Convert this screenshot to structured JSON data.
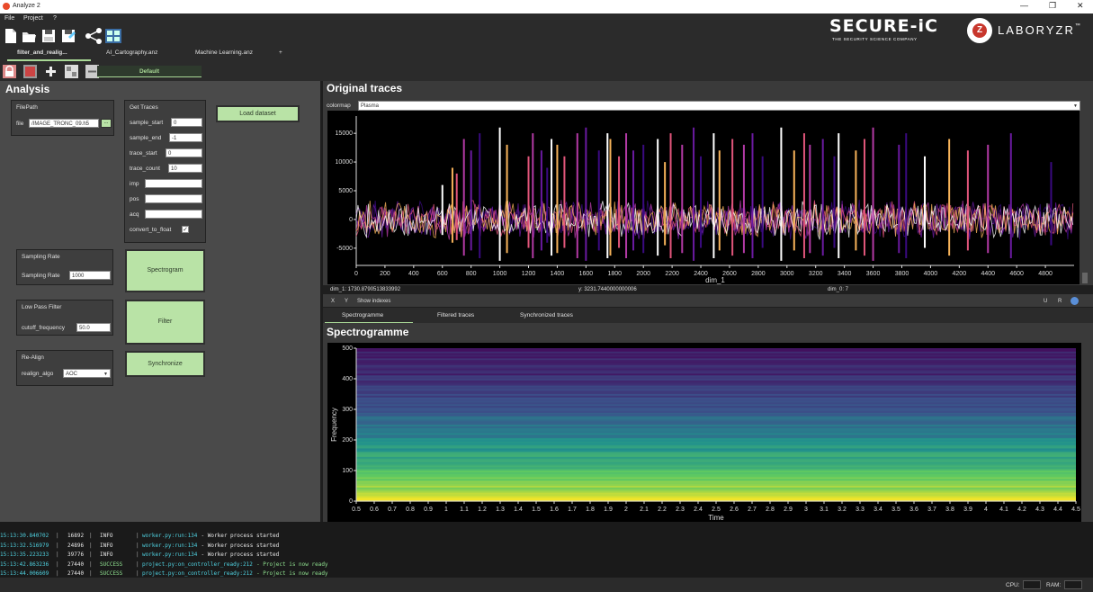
{
  "window": {
    "title": "Analyze 2",
    "controls": [
      "—",
      "❐",
      "✕"
    ]
  },
  "menu": [
    "File",
    "Project",
    "?"
  ],
  "toolbar": {
    "icons": [
      "new-file-icon",
      "open-folder-icon",
      "save-icon",
      "save-as-icon",
      "share-network-icon",
      "grid-layout-icon"
    ]
  },
  "brand": {
    "secure_main": "SECURE-iC",
    "secure_tagline": "THE SECURITY SCIENCE COMPANY",
    "lab_logo_letter": "Z",
    "lab_name": "LABORYZR",
    "lab_tm": "™"
  },
  "tabs": [
    {
      "label": "filter_and_realig..."
    },
    {
      "label": "AI_Cartography.anz"
    },
    {
      "label": "Machine Learning.anz"
    },
    {
      "label": "+"
    }
  ],
  "subbar": {
    "default_label": "Default"
  },
  "analysis": {
    "title": "Analysis",
    "filepath": {
      "title": "FilePath",
      "file_label": "file",
      "file_value": "/IMAGE_TRONC_09.h5",
      "browse_label": "..."
    },
    "get_traces": {
      "title": "Get Traces",
      "fields": [
        {
          "label": "sample_start",
          "value": "0"
        },
        {
          "label": "sample_end",
          "value": "-1"
        },
        {
          "label": "trace_start",
          "value": "0"
        },
        {
          "label": "trace_count",
          "value": "10"
        },
        {
          "label": "imp",
          "value": ""
        },
        {
          "label": "pos",
          "value": ""
        },
        {
          "label": "acq",
          "value": ""
        }
      ],
      "convert_label": "convert_to_float",
      "convert_checked": "✓"
    },
    "load_dataset_label": "Load dataset",
    "sampling": {
      "title": "Sampling Rate",
      "label": "Sampling Rate",
      "value": "1000",
      "button": "Spectrogram"
    },
    "lowpass": {
      "title": "Low Pass Filter",
      "label": "cutoff_frequency",
      "value": "50.0",
      "button": "Filter"
    },
    "realign": {
      "title": "Re-Align",
      "label": "realign_algo",
      "value": "AOC",
      "button": "Synchronize"
    }
  },
  "traces": {
    "title": "Original traces",
    "colormap_label": "colormap",
    "colormap_value": "Plasma",
    "status": {
      "dim1": "dim_1: 1730.8790513833992",
      "y": "y: 3231.7440000000006",
      "dim0": "dim_0: 7"
    },
    "tools": {
      "x": "X",
      "y": "Y",
      "show_indexes": "Show indexes",
      "u": "U",
      "r": "R"
    }
  },
  "bottom_tabs": [
    "Spectrogramme",
    "Filtered traces",
    "Synchronized traces"
  ],
  "spectrogram": {
    "title": "Spectrogramme"
  },
  "chart_data": [
    {
      "type": "line",
      "title": "",
      "xlabel": "dim_1",
      "ylabel": "",
      "xlim": [
        0,
        5000
      ],
      "ylim": [
        -8000,
        18000
      ],
      "x_ticks": [
        "0",
        "200",
        "400",
        "600",
        "800",
        "1000",
        "1200",
        "1400",
        "1600",
        "1800",
        "2000",
        "2200",
        "2400",
        "2600",
        "2800",
        "3000",
        "3200",
        "3400",
        "3600",
        "3800",
        "4000",
        "4200",
        "4400",
        "4600",
        "4800"
      ],
      "y_ticks": [
        "15000",
        "10000",
        "5000",
        "0",
        "-5000"
      ],
      "series_colors": [
        "#ffffff",
        "#f7b35a",
        "#e0557a",
        "#b33aa5",
        "#6a1aa0",
        "#3a0a80"
      ],
      "spike_positions": [
        600,
        670,
        700,
        750,
        800,
        860,
        1000,
        1050,
        1200,
        1230,
        1290,
        1330,
        1360,
        1400,
        1450,
        1540,
        1600,
        1690,
        1750,
        1770,
        1830,
        1880,
        1930,
        2000,
        2100,
        2150,
        2190,
        2270,
        2350,
        2400,
        2490,
        2530,
        2620,
        2700,
        2760,
        2830,
        2960,
        3050,
        3120,
        3160,
        3250,
        3330,
        3360,
        3480,
        3540,
        3600,
        3780,
        3830,
        3960,
        4130,
        4260,
        4400,
        4560,
        4840
      ],
      "spike_heights": [
        6000,
        9000,
        8000,
        14000,
        12000,
        15000,
        16000,
        13000,
        11000,
        15000,
        12000,
        9000,
        14000,
        13000,
        11000,
        15000,
        16000,
        12000,
        15000,
        14000,
        11000,
        15000,
        12000,
        13000,
        14000,
        10000,
        15000,
        13000,
        16000,
        11000,
        15000,
        12000,
        14000,
        13000,
        15000,
        11000,
        16000,
        12000,
        15000,
        13000,
        14000,
        11000,
        15000,
        12000,
        14000,
        16000,
        13000,
        15000,
        11000,
        14000,
        12000,
        13000,
        15000,
        10000
      ]
    },
    {
      "type": "heatmap",
      "title": "",
      "xlabel": "Time",
      "ylabel": "Frequency",
      "xlim": [
        0.5,
        4.5
      ],
      "ylim": [
        0,
        500
      ],
      "x_ticks": [
        "0.5",
        "0.6",
        "0.7",
        "0.8",
        "0.9",
        "1",
        "1.1",
        "1.2",
        "1.3",
        "1.4",
        "1.5",
        "1.6",
        "1.7",
        "1.8",
        "1.9",
        "2",
        "2.1",
        "2.2",
        "2.3",
        "2.4",
        "2.5",
        "2.6",
        "2.7",
        "2.8",
        "2.9",
        "3",
        "3.1",
        "3.2",
        "3.3",
        "3.4",
        "3.5",
        "3.6",
        "3.7",
        "3.8",
        "3.9",
        "4",
        "4.1",
        "4.2",
        "4.3",
        "4.4",
        "4.5"
      ],
      "y_ticks": [
        "500",
        "400",
        "300",
        "200",
        "100",
        "0"
      ],
      "colormap": [
        "#440154",
        "#3b528b",
        "#21918c",
        "#5ec962",
        "#fde725"
      ]
    }
  ],
  "console": [
    {
      "time": "15:13:30.840702",
      "pid": "16892",
      "level": "INFO",
      "src": "worker.py:run:134",
      "msg": "- Worker process started"
    },
    {
      "time": "15:13:32.516979",
      "pid": "24896",
      "level": "INFO",
      "src": "worker.py:run:134",
      "msg": "- Worker process started"
    },
    {
      "time": "15:13:35.223233",
      "pid": "39776",
      "level": "INFO",
      "src": "worker.py:run:134",
      "msg": "- Worker process started"
    },
    {
      "time": "15:13:42.863236",
      "pid": "27440",
      "level": "SUCCESS",
      "src": "project.py:on_controller_ready:212",
      "msg": "- Project is now ready"
    },
    {
      "time": "15:13:44.006609",
      "pid": "27440",
      "level": "SUCCESS",
      "src": "project.py:on_controller_ready:212",
      "msg": "- Project is now ready"
    }
  ],
  "status": {
    "cpu_label": "CPU:",
    "ram_label": "RAM:"
  }
}
